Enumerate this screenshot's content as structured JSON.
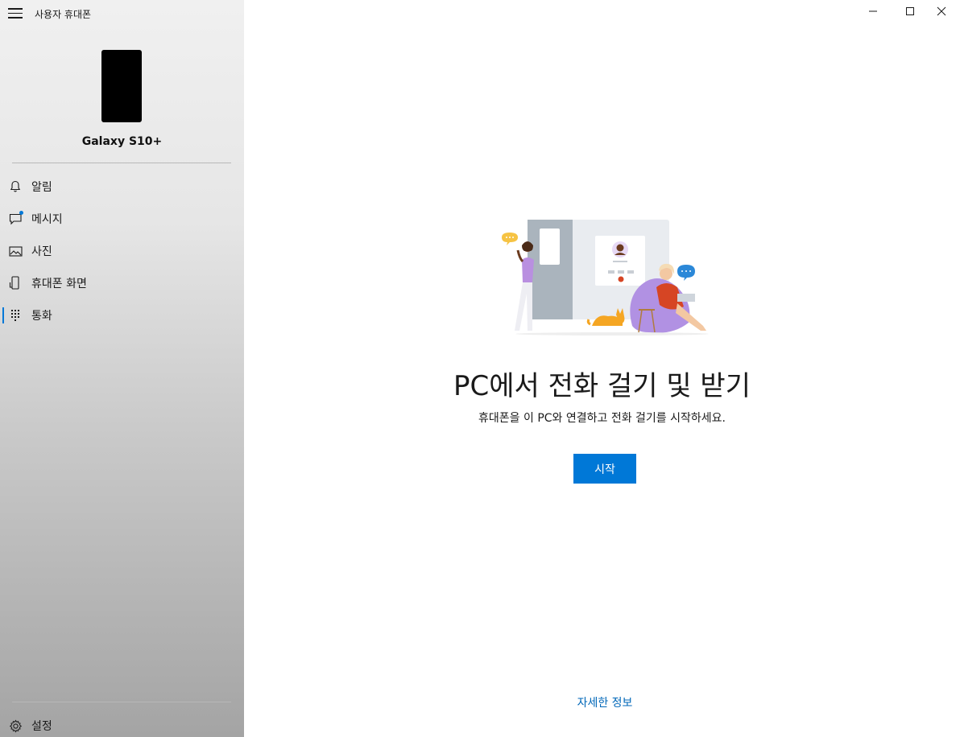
{
  "app": {
    "title": "사용자 휴대폰"
  },
  "device": {
    "name": "Galaxy S10+"
  },
  "nav": {
    "items": [
      {
        "label": "알림",
        "icon": "bell-icon"
      },
      {
        "label": "메시지",
        "icon": "message-icon",
        "badge": true
      },
      {
        "label": "사진",
        "icon": "photo-icon"
      },
      {
        "label": "휴대폰 화면",
        "icon": "phone-screen-icon"
      },
      {
        "label": "통화",
        "icon": "dialpad-icon",
        "active": true
      }
    ],
    "settings_label": "설정"
  },
  "main": {
    "title": "PC에서 전화 걸기 및 받기",
    "subtitle": "휴대폰을 이 PC와 연결하고 전화 걸기를 시작하세요.",
    "start_button": "시작",
    "more_info_link": "자세한 정보"
  },
  "colors": {
    "accent": "#0078d7",
    "link": "#0067b8"
  }
}
